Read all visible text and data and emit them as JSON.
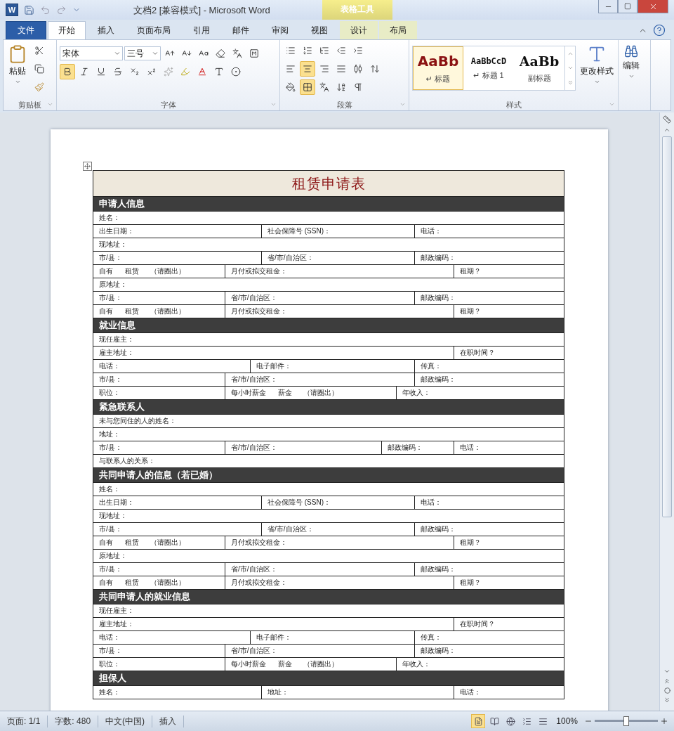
{
  "window": {
    "app_letter": "W",
    "title": "文档2 [兼容模式]  -  Microsoft Word",
    "context_group": "表格工具"
  },
  "tabs": [
    {
      "label": "文件",
      "kind": "file",
      "selected": false
    },
    {
      "label": "开始",
      "kind": "normal",
      "selected": true
    },
    {
      "label": "插入",
      "kind": "normal",
      "selected": false
    },
    {
      "label": "页面布局",
      "kind": "normal",
      "selected": false
    },
    {
      "label": "引用",
      "kind": "normal",
      "selected": false
    },
    {
      "label": "邮件",
      "kind": "normal",
      "selected": false
    },
    {
      "label": "审阅",
      "kind": "normal",
      "selected": false
    },
    {
      "label": "视图",
      "kind": "normal",
      "selected": false
    },
    {
      "label": "设计",
      "kind": "context",
      "selected": false
    },
    {
      "label": "布局",
      "kind": "context",
      "selected": false
    }
  ],
  "ribbon": {
    "clipboard": {
      "label": "剪贴板",
      "paste": "粘贴"
    },
    "font": {
      "label": "字体",
      "name": "宋体",
      "size": "三号",
      "rows": [
        [
          {
            "kind": "grow",
            "selected": false
          },
          {
            "kind": "shrink",
            "selected": false
          },
          {
            "kind": "case",
            "selected": false
          },
          {
            "kind": "clear",
            "selected": false
          },
          {
            "kind": "phonetic",
            "selected": false
          },
          {
            "kind": "border",
            "selected": false
          }
        ],
        [
          {
            "kind": "bold",
            "selected": true
          },
          {
            "kind": "italic",
            "selected": false
          },
          {
            "kind": "underline",
            "selected": false
          },
          {
            "kind": "strike",
            "selected": false
          },
          {
            "kind": "sub",
            "selected": false
          },
          {
            "kind": "sup",
            "selected": false
          },
          {
            "kind": "effects",
            "selected": false
          },
          {
            "kind": "highlight",
            "selected": false
          },
          {
            "kind": "color",
            "selected": false
          },
          {
            "kind": "shading",
            "selected": false
          },
          {
            "kind": "enclose",
            "selected": false
          }
        ]
      ]
    },
    "paragraph": {
      "label": "段落",
      "rows": [
        [
          {
            "kind": "bullets",
            "selected": false
          },
          {
            "kind": "numbering",
            "selected": false
          },
          {
            "kind": "multilevel",
            "selected": false
          },
          {
            "kind": "outdent",
            "selected": false
          },
          {
            "kind": "indent",
            "selected": false
          }
        ],
        [
          {
            "kind": "left",
            "selected": false
          },
          {
            "kind": "center",
            "selected": true
          },
          {
            "kind": "right",
            "selected": false
          },
          {
            "kind": "justify",
            "selected": false
          },
          {
            "kind": "distribute",
            "selected": false
          },
          {
            "kind": "spacing",
            "selected": false
          }
        ],
        [
          {
            "kind": "fill",
            "selected": false
          },
          {
            "kind": "borders",
            "selected": true
          },
          {
            "kind": "chinese",
            "selected": false
          },
          {
            "kind": "sort",
            "selected": false
          },
          {
            "kind": "marks",
            "selected": false
          }
        ]
      ]
    },
    "styles": {
      "label": "样式",
      "items": [
        {
          "kind": "title",
          "preview": "AaBb",
          "label": "↵ 标题",
          "selected": true
        },
        {
          "kind": "heading",
          "preview": "AaBbCcD",
          "label": "↵ 标题 1",
          "selected": false
        },
        {
          "kind": "subtitle",
          "preview": "AaBb",
          "label": "副标题",
          "selected": false
        }
      ],
      "change": "更改样式"
    },
    "editing": {
      "label": "编辑"
    }
  },
  "form": {
    "title": "租赁申请表",
    "sections": [
      {
        "heading": "申请人信息",
        "rows": [
          {
            "kind": "one",
            "cells": [
              "姓名："
            ]
          },
          {
            "kind": "a",
            "cells": [
              "出生日期：",
              "社会保障号 (SSN)：",
              "电话："
            ]
          },
          {
            "kind": "one",
            "cells": [
              "现地址："
            ]
          },
          {
            "kind": "a",
            "cells": [
              "市/县：",
              "省/市/自治区：",
              "邮政编码："
            ]
          },
          {
            "kind": "b",
            "cells": [
              "自有      租赁      （请圈出）",
              "月付或拟交租金：",
              "租期？"
            ]
          },
          {
            "kind": "one",
            "cells": [
              "原地址："
            ]
          },
          {
            "kind": "c",
            "cells": [
              "市/县：",
              "省/市/自治区：",
              "邮政编码："
            ]
          },
          {
            "kind": "b",
            "cells": [
              "自有      租赁      （请圈出）",
              "月付或拟交租金：",
              "租期？"
            ]
          }
        ]
      },
      {
        "heading": "就业信息",
        "rows": [
          {
            "kind": "one",
            "cells": [
              "现任雇主："
            ]
          },
          {
            "kind": "d",
            "cells": [
              "雇主地址：",
              "在职时间？"
            ]
          },
          {
            "kind": "e",
            "cells": [
              "电话：",
              "电子邮件：",
              "传真："
            ]
          },
          {
            "kind": "c",
            "cells": [
              "市/县：",
              "省/市/自治区：",
              "邮政编码："
            ]
          },
          {
            "kind": "f",
            "cells": [
              "职位：",
              "每小时薪金      薪金      （请圈出）",
              "年收入："
            ]
          }
        ]
      },
      {
        "heading": "紧急联系人",
        "rows": [
          {
            "kind": "one",
            "cells": [
              "未与您同住的人的姓名："
            ]
          },
          {
            "kind": "one",
            "cells": [
              "地址："
            ]
          },
          {
            "kind": "g",
            "cells": [
              "市/县：",
              "省/市/自治区：",
              "邮政编码：",
              "电话："
            ]
          },
          {
            "kind": "one",
            "cells": [
              "与联系人的关系："
            ]
          }
        ]
      },
      {
        "heading": "共同申请人的信息（若已婚）",
        "rows": [
          {
            "kind": "one",
            "cells": [
              "姓名："
            ]
          },
          {
            "kind": "a",
            "cells": [
              "出生日期：",
              "社会保障号 (SSN)：",
              "电话："
            ]
          },
          {
            "kind": "one",
            "cells": [
              "现地址："
            ]
          },
          {
            "kind": "a",
            "cells": [
              "市/县：",
              "省/市/自治区：",
              "邮政编码："
            ]
          },
          {
            "kind": "b",
            "cells": [
              "自有      租赁      （请圈出）",
              "月付或拟交租金：",
              "租期？"
            ]
          },
          {
            "kind": "one",
            "cells": [
              "原地址："
            ]
          },
          {
            "kind": "c",
            "cells": [
              "市/县：",
              "省/市/自治区：",
              "邮政编码："
            ]
          },
          {
            "kind": "b",
            "cells": [
              "自有      租赁      （请圈出）",
              "月付或拟交租金：",
              "租期？"
            ]
          }
        ]
      },
      {
        "heading": "共同申请人的就业信息",
        "rows": [
          {
            "kind": "one",
            "cells": [
              "现任雇主："
            ]
          },
          {
            "kind": "d",
            "cells": [
              "雇主地址：",
              "在职时间？"
            ]
          },
          {
            "kind": "e",
            "cells": [
              "电话：",
              "电子邮件：",
              "传真："
            ]
          },
          {
            "kind": "c",
            "cells": [
              "市/县：",
              "省/市/自治区：",
              "邮政编码："
            ]
          },
          {
            "kind": "f",
            "cells": [
              "职位：",
              "每小时薪金      薪金      （请圈出）",
              "年收入："
            ]
          }
        ]
      },
      {
        "heading": "担保人",
        "rows": [
          {
            "kind": "h",
            "cells": [
              "姓名：",
              "地址：",
              "电话："
            ]
          }
        ]
      }
    ]
  },
  "status_bar": {
    "items": [
      "页面: 1/1",
      "字数: 480",
      "中文(中国)",
      "插入"
    ],
    "views": [
      {
        "selected": true
      },
      {
        "selected": false
      },
      {
        "selected": false
      },
      {
        "selected": false
      },
      {
        "selected": false
      }
    ],
    "zoom": "100%",
    "zoom_slider": {
      "level": 0.5
    }
  }
}
